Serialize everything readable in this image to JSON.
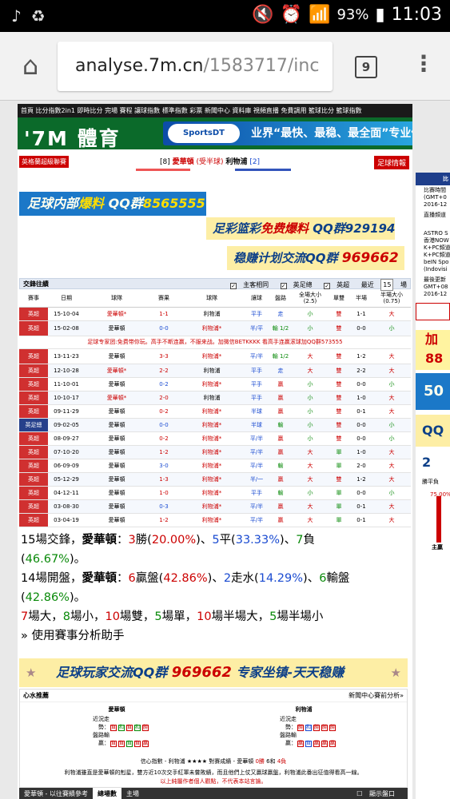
{
  "status": {
    "battery": "93%",
    "time": "11:03"
  },
  "browser": {
    "url_domain": "analyse.7m.cn",
    "url_path": "/1583717/inc",
    "tab_count": "9"
  },
  "site": {
    "topnav": "首頁 比分指數2in1 即時比分 完場 賽程 讓球指數 標準指數 彩票   新聞中心 資料庫 視頻直播 免費調用 籃球比分 籃球指數",
    "logo": "'7M 體育",
    "banner_ad": {
      "sponsor": "SportsDT",
      "text": "业界“最快、最稳、最全面”专业体育数据服"
    }
  },
  "match": {
    "league": "英格蘭超級聯賽",
    "home_rank": "[8]",
    "home": "愛華頓",
    "handicap": "(受半球)",
    "away": "利物浦",
    "away_rank": "[2]",
    "info_label": "足球情報"
  },
  "ads": {
    "qq1_a": "足球内部",
    "qq1_b": "爆料",
    "qq1_c": " QQ群",
    "qq1_d": "8565555",
    "qq2_a": "足彩篮彩",
    "qq2_b": "免费爆料",
    "qq2_c": " QQ群929194",
    "qq3_a": "稳赚计划交流QQ群 ",
    "qq3_b": "969662",
    "star_a": "足球玩家交流QQ群 ",
    "star_b": "969662",
    "star_c": " 专家坐镇-天天稳赚"
  },
  "h2h": {
    "title": "交鋒往績",
    "opt_same": "主客相同",
    "opt_league": "英足總",
    "opt_epl": "英超",
    "recent_label": "最近",
    "recent_value": "15",
    "recent_unit": "場",
    "headers": [
      "賽事",
      "日期",
      "球隊",
      "賽果",
      "球隊",
      "讓球",
      "盤路",
      "全場大小 (2.5)",
      "單雙",
      "半場",
      "半場大小 (0.75)"
    ],
    "notice": "足球专家团:免费带你玩。高手不断连赢，不服来战。加微信BETKKKK 看高手连赢滚球加QQ群573555",
    "rows": [
      {
        "lg": "英超",
        "date": "15-10-04",
        "home": "愛華頓*",
        "score": "1-1",
        "away": "利物浦",
        "hcp": "平手",
        "pan": "走",
        "size": "小",
        "oe": "雙",
        "half": "1-1",
        "hsize": "大"
      },
      {
        "lg": "英超",
        "date": "15-02-08",
        "home": "愛華頓",
        "score": "0-0",
        "away": "利物浦*",
        "hcp": "半/平",
        "pan": "輸 1/2",
        "size": "小",
        "oe": "雙",
        "half": "0-0",
        "hsize": "小"
      },
      {
        "lg": "英超",
        "date": "13-11-23",
        "home": "愛華頓",
        "score": "3-3",
        "away": "利物浦*",
        "hcp": "平/半",
        "pan": "輸 1/2",
        "size": "大",
        "oe": "雙",
        "half": "1-2",
        "hsize": "大"
      },
      {
        "lg": "英超",
        "date": "12-10-28",
        "home": "愛華頓*",
        "score": "2-2",
        "away": "利物浦",
        "hcp": "平手",
        "pan": "走",
        "size": "大",
        "oe": "雙",
        "half": "2-2",
        "hsize": "大"
      },
      {
        "lg": "英超",
        "date": "11-10-01",
        "home": "愛華頓",
        "score": "0-2",
        "away": "利物浦*",
        "hcp": "平手",
        "pan": "贏",
        "size": "小",
        "oe": "雙",
        "half": "0-0",
        "hsize": "小"
      },
      {
        "lg": "英超",
        "date": "10-10-17",
        "home": "愛華頓*",
        "score": "2-0",
        "away": "利物浦",
        "hcp": "平手",
        "pan": "贏",
        "size": "小",
        "oe": "雙",
        "half": "1-0",
        "hsize": "大"
      },
      {
        "lg": "英超",
        "date": "09-11-29",
        "home": "愛華頓",
        "score": "0-2",
        "away": "利物浦*",
        "hcp": "半球",
        "pan": "贏",
        "size": "小",
        "oe": "雙",
        "half": "0-1",
        "hsize": "大"
      },
      {
        "lg": "英足總",
        "date": "09-02-05",
        "home": "愛華頓",
        "score": "0-0",
        "away": "利物浦*",
        "hcp": "半球",
        "pan": "輸",
        "size": "小",
        "oe": "雙",
        "half": "0-0",
        "hsize": "小"
      },
      {
        "lg": "英超",
        "date": "08-09-27",
        "home": "愛華頓",
        "score": "0-2",
        "away": "利物浦*",
        "hcp": "平/半",
        "pan": "贏",
        "size": "小",
        "oe": "雙",
        "half": "0-0",
        "hsize": "小"
      },
      {
        "lg": "英超",
        "date": "07-10-20",
        "home": "愛華頓",
        "score": "1-2",
        "away": "利物浦*",
        "hcp": "平/半",
        "pan": "贏",
        "size": "大",
        "oe": "單",
        "half": "1-0",
        "hsize": "大"
      },
      {
        "lg": "英超",
        "date": "06-09-09",
        "home": "愛華頓",
        "score": "3-0",
        "away": "利物浦*",
        "hcp": "平/半",
        "pan": "輸",
        "size": "大",
        "oe": "單",
        "half": "2-0",
        "hsize": "大"
      },
      {
        "lg": "英超",
        "date": "05-12-29",
        "home": "愛華頓",
        "score": "1-3",
        "away": "利物浦*",
        "hcp": "半/一",
        "pan": "贏",
        "size": "大",
        "oe": "雙",
        "half": "1-2",
        "hsize": "大"
      },
      {
        "lg": "英超",
        "date": "04-12-11",
        "home": "愛華頓",
        "score": "1-0",
        "away": "利物浦*",
        "hcp": "平手",
        "pan": "輸",
        "size": "小",
        "oe": "單",
        "half": "0-0",
        "hsize": "小"
      },
      {
        "lg": "英超",
        "date": "03-08-30",
        "home": "愛華頓",
        "score": "0-3",
        "away": "利物浦*",
        "hcp": "平/半",
        "pan": "贏",
        "size": "大",
        "oe": "單",
        "half": "0-1",
        "hsize": "大"
      },
      {
        "lg": "英超",
        "date": "03-04-19",
        "home": "愛華頓",
        "score": "1-2",
        "away": "利物浦*",
        "hcp": "平/半",
        "pan": "贏",
        "size": "大",
        "oe": "單",
        "half": "0-1",
        "hsize": "大"
      }
    ]
  },
  "summary": {
    "l1_a": "15場交鋒，",
    "l1_team": "愛華頓",
    "l1_b": "：",
    "w": "3",
    "l1_c": "勝(",
    "wp": "20.00%",
    "l1_d": ")、",
    "d": "5",
    "l1_e": "平(",
    "dp": "33.33%",
    "l1_f": ")、",
    "l": "7",
    "l1_g": "負",
    "l1_h": "(",
    "lp": "46.67%",
    "l1_i": ")。",
    "l2_a": "14場開盤，",
    "l2_team": "愛華頓",
    "l2_b": "：",
    "win": "6",
    "l2_c": "贏盤(",
    "winp": "42.86%",
    "l2_d": ")、",
    "push": "2",
    "l2_e": "走水(",
    "pushp": "14.29%",
    "l2_f": ")、",
    "lose": "6",
    "l2_g": "輸盤",
    "l2_h": "(",
    "losep": "42.86%",
    "l2_i": ")。",
    "l3_big": "7",
    "l3_a": "場大，",
    "l3_small": "8",
    "l3_b": "場小，",
    "l3_even": "10",
    "l3_c": "場雙，",
    "l3_odd": "5",
    "l3_d": "場單，",
    "l3_hbig": "10",
    "l3_e": "場半場大，",
    "l3_hsmall": "5",
    "l3_f": "場半場小",
    "assistant": "» 使用賽事分析助手"
  },
  "tips": {
    "title": "心水推薦",
    "more": "新聞中心賽前分析»",
    "home": "愛華頓",
    "away": "利物浦",
    "recent_label": "近況走勢：",
    "pan_label": "盤路輸贏：",
    "confidence": "信心指數 - 利物浦",
    "stars": "★★★★",
    "fav_a": " 對賽成績 - 愛華頓 ",
    "fav_b": "0勝",
    "fav_c": " 6和 ",
    "fav_d": "4負",
    "analysis": "利物浦雖直是愛華頓的剋星，雙方近10次交手紅軍未嘗敗績，而且他們上仗又贏球贏盤，利物浦此番出征值得看高一線。",
    "warning": "以上純屬作者個人觀點，不代表本站言論。"
  },
  "bottom": {
    "tab1": "愛華頓 - 以往賽績參考",
    "tab2": "總場數",
    "tab3": "主場",
    "show_odds": "顯示盤口"
  },
  "side": {
    "head": "比",
    "l1": "比賽時間",
    "l2": "(GMT+0",
    "l3": "2016-12",
    "l4": "直播頻道",
    "l5": "ASTRO S",
    "l6": "香港NOW",
    "l7": "K+PC頻道",
    "l8": "K+PC頻道",
    "l9": "beIN Spo",
    "l10": "(Indovisi",
    "l11": "最後更新",
    "l12": "GMT+08",
    "l13": "2016-12",
    "ad1a": "加",
    "ad1b": "88",
    "ad2": "50",
    "ad3": "QQ 2",
    "chart_label": "勝平負",
    "pct": "75.00%",
    "bar_label": "主贏"
  }
}
